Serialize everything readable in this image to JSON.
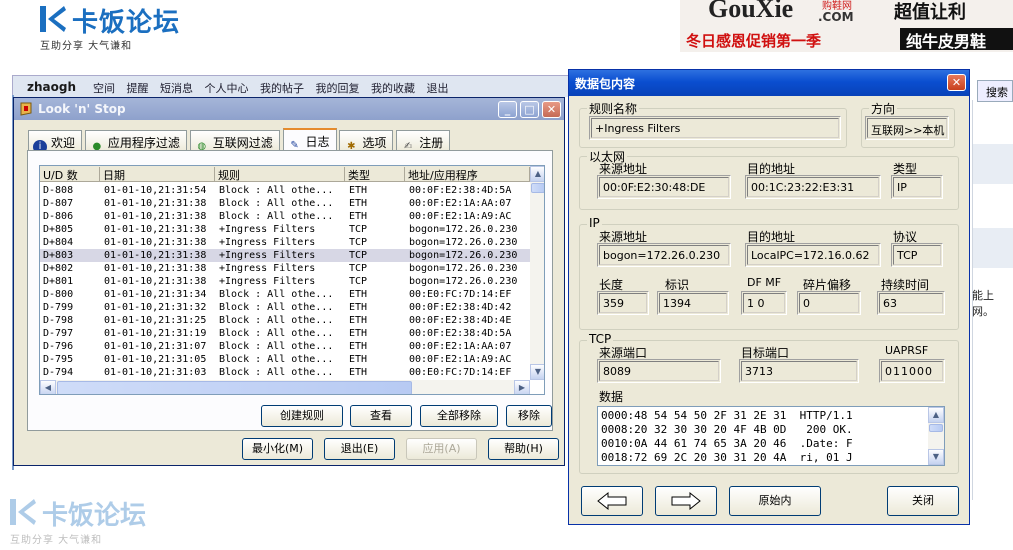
{
  "forum": {
    "logo_text": "卡饭论坛",
    "logo_slogan": "互助分享    大气谦和",
    "ad": {
      "brand": "GouXie",
      "brand_cn": "购鞋网",
      "brand_suffix": ".COM",
      "tagline": "冬日感恩促销第一季",
      "deal": "超值让利",
      "product": "纯牛皮男鞋"
    },
    "nav": {
      "user": "zhaogh",
      "links": [
        "空间",
        "提醒",
        "短消息",
        "个人中心",
        "我的帖子",
        "我的回复",
        "我的收藏",
        "退出"
      ]
    },
    "search_label": "搜索",
    "page_fragment": "能上网。",
    "bottom_logo_text": "卡饭论坛",
    "bottom_logo_slogan": "互助分享    大气谦和"
  },
  "lns": {
    "title": "Look 'n' Stop",
    "tabs": [
      "欢迎",
      "应用程序过滤",
      "互联网过滤",
      "日志",
      "选项",
      "注册"
    ],
    "active_tab": 3,
    "columns": [
      "U/D 数",
      "日期",
      "规则",
      "类型",
      "地址/应用程序"
    ],
    "rows": [
      [
        "D-808",
        "01-01-10,21:31:54",
        "Block : All othe...",
        "ETH",
        "00:0F:E2:38:4D:5A"
      ],
      [
        "D-807",
        "01-01-10,21:31:38",
        "Block : All othe...",
        "ETH",
        "00:0F:E2:1A:AA:07"
      ],
      [
        "D-806",
        "01-01-10,21:31:38",
        "Block : All othe...",
        "ETH",
        "00:0F:E2:1A:A9:AC"
      ],
      [
        "D+805",
        "01-01-10,21:31:38",
        "+Ingress Filters",
        "TCP",
        "bogon=172.26.0.230"
      ],
      [
        "D+804",
        "01-01-10,21:31:38",
        "+Ingress Filters",
        "TCP",
        "bogon=172.26.0.230"
      ],
      [
        "D+803",
        "01-01-10,21:31:38",
        "+Ingress Filters",
        "TCP",
        "bogon=172.26.0.230"
      ],
      [
        "D+802",
        "01-01-10,21:31:38",
        "+Ingress Filters",
        "TCP",
        "bogon=172.26.0.230"
      ],
      [
        "D+801",
        "01-01-10,21:31:38",
        "+Ingress Filters",
        "TCP",
        "bogon=172.26.0.230"
      ],
      [
        "D-800",
        "01-01-10,21:31:34",
        "Block : All othe...",
        "ETH",
        "00:E0:FC:7D:14:EF"
      ],
      [
        "D-799",
        "01-01-10,21:31:32",
        "Block : All othe...",
        "ETH",
        "00:0F:E2:38:4D:42"
      ],
      [
        "D-798",
        "01-01-10,21:31:25",
        "Block : All othe...",
        "ETH",
        "00:0F:E2:38:4D:4E"
      ],
      [
        "D-797",
        "01-01-10,21:31:19",
        "Block : All othe...",
        "ETH",
        "00:0F:E2:38:4D:5A"
      ],
      [
        "D-796",
        "01-01-10,21:31:07",
        "Block : All othe...",
        "ETH",
        "00:0F:E2:1A:AA:07"
      ],
      [
        "D-795",
        "01-01-10,21:31:05",
        "Block : All othe...",
        "ETH",
        "00:0F:E2:1A:A9:AC"
      ],
      [
        "D-794",
        "01-01-10,21:31:03",
        "Block : All othe...",
        "ETH",
        "00:E0:FC:7D:14:EF"
      ]
    ],
    "selected_row": 5,
    "panel_buttons": [
      "创建规则",
      "查看",
      "全部移除",
      "移除"
    ],
    "bottom_buttons": [
      "最小化(M)",
      "退出(E)",
      "应用(A)",
      "帮助(H)"
    ]
  },
  "packet": {
    "title": "数据包内容",
    "rule_name_label": "规则名称",
    "rule_name": "+Ingress Filters",
    "direction_label": "方向",
    "direction": "互联网>>本机",
    "ethernet_label": "以太网",
    "eth_src_label": "来源地址",
    "eth_src": "00:0F:E2:30:48:DE",
    "eth_dst_label": "目的地址",
    "eth_dst": "00:1C:23:22:E3:31",
    "eth_type_label": "类型",
    "eth_type": "IP",
    "ip_label": "IP",
    "ip_src_label": "来源地址",
    "ip_src": "bogon=172.26.0.230",
    "ip_dst_label": "目的地址",
    "ip_dst": "LocalPC=172.16.0.62",
    "protocol_label": "协议",
    "protocol": "TCP",
    "length_label": "长度",
    "length": "359",
    "ident_label": "标识",
    "ident": "1394",
    "dfmf_label": "DF MF",
    "dfmf": "1 0",
    "frag_label": "碎片偏移",
    "frag": "0",
    "ttl_label": "持续时间",
    "ttl": "63",
    "tcp_label": "TCP",
    "src_port_label": "来源端口",
    "src_port": "8089",
    "dst_port_label": "目标端口",
    "dst_port": "3713",
    "flags_label": "UAPRSF",
    "flags": "011000",
    "data_label": "数据",
    "hex_lines": [
      "0000:48 54 54 50 2F 31 2E 31  HTTP/1.1",
      "0008:20 32 30 30 20 4F 4B 0D   200 OK.",
      "0010:0A 44 61 74 65 3A 20 46  .Date: F",
      "0018:72 69 2C 20 30 31 20 4A  ri, 01 J"
    ],
    "raw_button": "原始内",
    "close_button": "关闭"
  }
}
